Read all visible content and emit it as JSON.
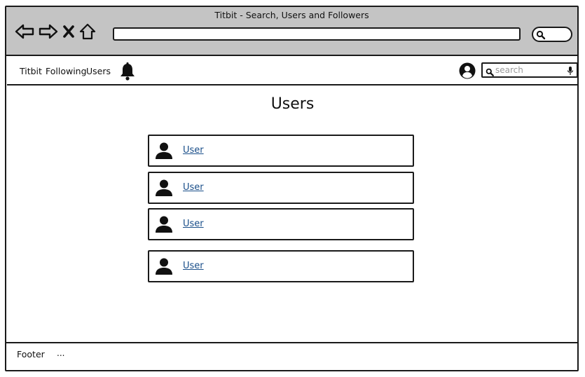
{
  "browser": {
    "title": "Titbit - Search, Users and Followers"
  },
  "nav": {
    "brand": "Titbit",
    "following": "Following",
    "users": "Users",
    "search_placeholder": "search"
  },
  "page": {
    "title": "Users"
  },
  "users": [
    {
      "label": "User"
    },
    {
      "label": "User"
    },
    {
      "label": "User"
    },
    {
      "label": "User"
    }
  ],
  "footer": {
    "label": "Footer",
    "more": "..."
  },
  "icons": {
    "back": "back-arrow-icon",
    "forward": "forward-arrow-icon",
    "close": "close-icon",
    "home": "home-icon",
    "browser_search": "search-icon",
    "notifications": "bell-icon",
    "account": "user-circle-icon",
    "search": "search-icon",
    "mic": "microphone-icon",
    "user": "user-icon"
  },
  "colors": {
    "chrome": "#c4c4c4",
    "link": "#1a4f8a",
    "border": "#1a1a1a"
  }
}
